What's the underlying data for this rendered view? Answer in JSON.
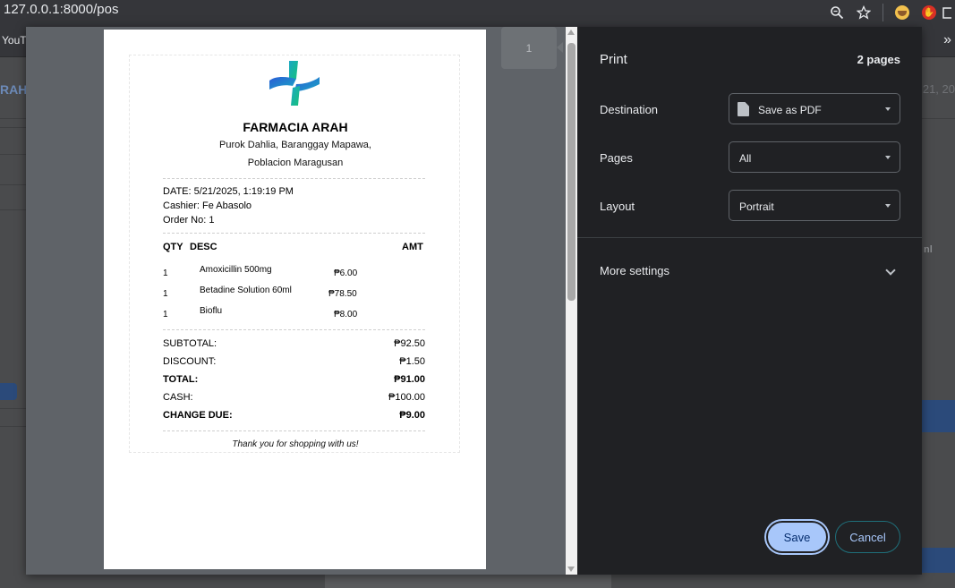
{
  "browser": {
    "url_host": "127.0.0.1",
    "url_path": ":8000/pos",
    "bookmark_label": "YouTu",
    "more_bookmarks": "»"
  },
  "background_page": {
    "left_title": "RAH",
    "right_date": "21, 20",
    "right_fragment": "nl"
  },
  "print_dialog": {
    "title": "Print",
    "page_count": "2 pages",
    "destination_label": "Destination",
    "destination_value": "Save as PDF",
    "pages_label": "Pages",
    "pages_value": "All",
    "layout_label": "Layout",
    "layout_value": "Portrait",
    "more_settings_label": "More settings",
    "save_label": "Save",
    "cancel_label": "Cancel",
    "thumbnail_number": "1"
  },
  "receipt": {
    "store_name": "FARMACIA ARAH",
    "address_line1": "Purok Dahlia, Baranggay Mapawa,",
    "address_line2": "Poblacion Maragusan",
    "date": "DATE: 5/21/2025, 1:19:19 PM",
    "cashier": "Cashier: Fe Abasolo",
    "order_no": "Order No: 1",
    "headers": {
      "qty": "QTY",
      "desc": "DESC",
      "amt": "AMT"
    },
    "items": [
      {
        "qty": "1",
        "desc": "Amoxicillin 500mg",
        "amt": "₱6.00"
      },
      {
        "qty": "1",
        "desc": "Betadine Solution 60ml",
        "amt": "₱78.50"
      },
      {
        "qty": "1",
        "desc": "Bioflu",
        "amt": "₱8.00"
      }
    ],
    "subtotal_label": "SUBTOTAL:",
    "subtotal_value": "₱92.50",
    "discount_label": "DISCOUNT:",
    "discount_value": "₱1.50",
    "total_label": "TOTAL:",
    "total_value": "₱91.00",
    "cash_label": "CASH:",
    "cash_value": "₱100.00",
    "change_label": "CHANGE DUE:",
    "change_value": "₱9.00",
    "thank_you": "Thank you for shopping with us!"
  },
  "colors": {
    "logo_blue": "#1f6fd0",
    "logo_green": "#14b87a",
    "save_button": "#a8c7fa",
    "panel_bg": "#202124"
  }
}
